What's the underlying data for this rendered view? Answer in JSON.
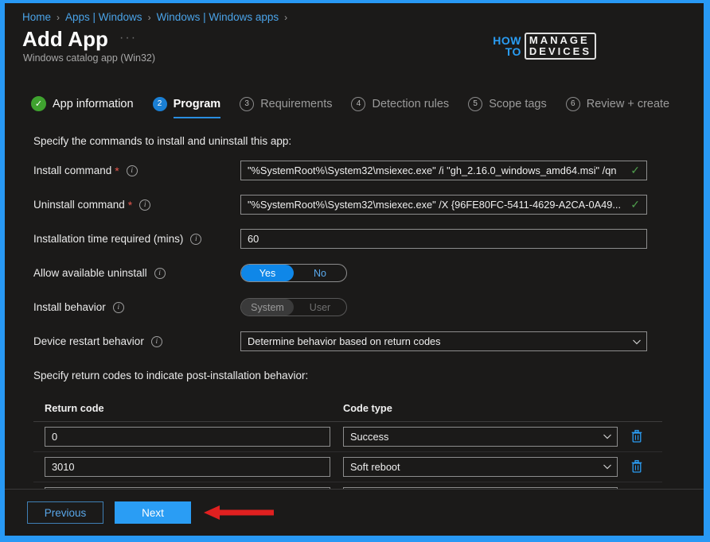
{
  "breadcrumb": {
    "items": [
      "Home",
      "Apps | Windows",
      "Windows | Windows apps"
    ],
    "separator": "›"
  },
  "header": {
    "title": "Add App",
    "subtitle": "Windows catalog app (Win32)",
    "more_menu": "···"
  },
  "logo": {
    "how": "HOW",
    "to": "TO",
    "manage": "MANAGE",
    "devices": "DEVICES"
  },
  "steps": [
    {
      "badge": "✓",
      "label": "App information",
      "state": "done"
    },
    {
      "badge": "2",
      "label": "Program",
      "state": "active"
    },
    {
      "badge": "3",
      "label": "Requirements",
      "state": "todo"
    },
    {
      "badge": "4",
      "label": "Detection rules",
      "state": "todo"
    },
    {
      "badge": "5",
      "label": "Scope tags",
      "state": "todo"
    },
    {
      "badge": "6",
      "label": "Review + create",
      "state": "todo"
    }
  ],
  "form": {
    "intro": "Specify the commands to install and uninstall this app:",
    "install_command": {
      "label": "Install command",
      "required": "*",
      "info": "i",
      "value": "\"%SystemRoot%\\System32\\msiexec.exe\" /i \"gh_2.16.0_windows_amd64.msi\" /qn",
      "valid_mark": "✓"
    },
    "uninstall_command": {
      "label": "Uninstall command",
      "required": "*",
      "info": "i",
      "value": "\"%SystemRoot%\\System32\\msiexec.exe\" /X {96FE80FC-5411-4629-A2CA-0A49...",
      "valid_mark": "✓"
    },
    "install_time": {
      "label": "Installation time required (mins)",
      "info": "i",
      "value": "60"
    },
    "allow_uninstall": {
      "label": "Allow available uninstall",
      "info": "i",
      "options": [
        "Yes",
        "No"
      ],
      "selected": "Yes"
    },
    "install_behavior": {
      "label": "Install behavior",
      "info": "i",
      "options": [
        "System",
        "User"
      ],
      "selected": "System",
      "disabled": true
    },
    "device_restart": {
      "label": "Device restart behavior",
      "info": "i",
      "value": "Determine behavior based on return codes"
    },
    "return_codes_intro": "Specify return codes to indicate post-installation behavior:"
  },
  "return_codes": {
    "headers": [
      "Return code",
      "Code type"
    ],
    "rows": [
      {
        "code": "0",
        "type": "Success"
      },
      {
        "code": "3010",
        "type": "Soft reboot"
      },
      {
        "code": "",
        "type": ""
      }
    ],
    "delete_icon": "trash-icon"
  },
  "footer": {
    "previous": "Previous",
    "next": "Next"
  },
  "colors": {
    "accent": "#2a9df4",
    "window_border": "#2899f5",
    "success": "#3fa22f",
    "required": "#e8584e",
    "annotation_arrow": "#e02020"
  }
}
